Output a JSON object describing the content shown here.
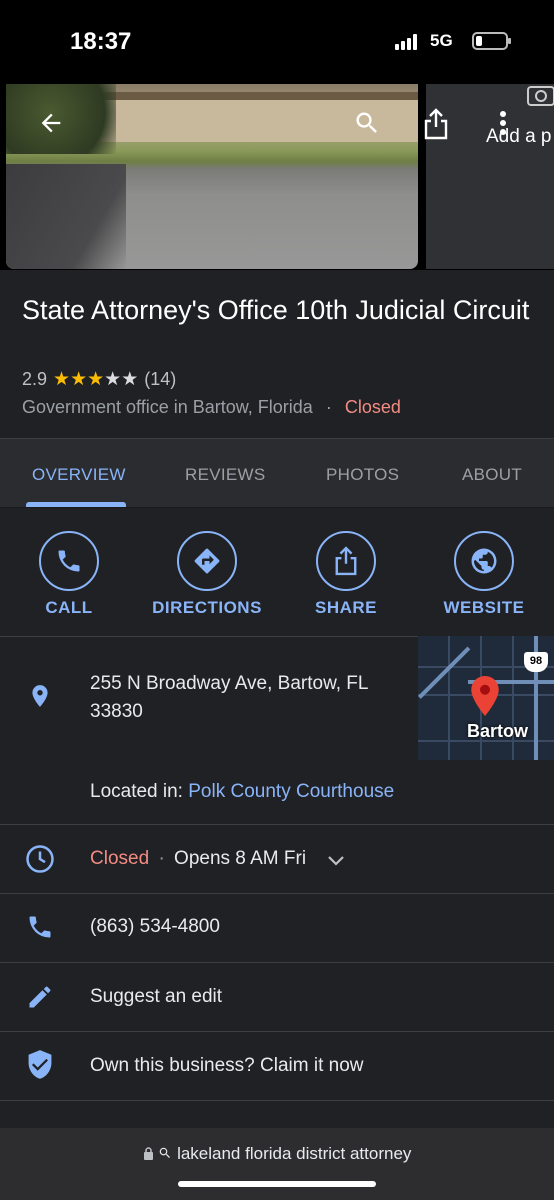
{
  "status_bar": {
    "time": "18:37",
    "network": "5G",
    "battery_level": 0.2
  },
  "hero": {
    "add_photo_label": "Add a p"
  },
  "place": {
    "name": "State Attorney's Office 10th Judicial Circuit",
    "rating": "2.9",
    "rating_value": 2.9,
    "stars_filled": 3,
    "stars_total": 5,
    "review_count": "(14)",
    "category": "Government office in Bartow, Florida",
    "separator": "·",
    "status": "Closed"
  },
  "tabs": [
    {
      "label": "OVERVIEW",
      "active": true
    },
    {
      "label": "REVIEWS",
      "active": false
    },
    {
      "label": "PHOTOS",
      "active": false
    },
    {
      "label": "ABOUT",
      "active": false
    }
  ],
  "actions": [
    {
      "label": "CALL",
      "icon": "phone-icon"
    },
    {
      "label": "DIRECTIONS",
      "icon": "directions-icon"
    },
    {
      "label": "SHARE",
      "icon": "share-icon"
    },
    {
      "label": "WEBSITE",
      "icon": "globe-icon"
    }
  ],
  "address": {
    "line1": "255 N Broadway Ave, Bartow, FL",
    "line2": "33830"
  },
  "map": {
    "city_label": "Bartow",
    "route_shield": "98"
  },
  "located_in": {
    "prefix": "Located in:",
    "place": "Polk County Courthouse"
  },
  "hours": {
    "status": "Closed",
    "separator": "·",
    "next": "Opens 8 AM Fri"
  },
  "phone": "(863) 534-4800",
  "suggest_edit": "Suggest an edit",
  "claim": "Own this business? Claim it now",
  "browser": {
    "url": "lakeland florida district attorney"
  },
  "colors": {
    "accent": "#8ab4f8",
    "closed": "#f28b82",
    "star": "#fbbc04",
    "background": "#202124"
  }
}
